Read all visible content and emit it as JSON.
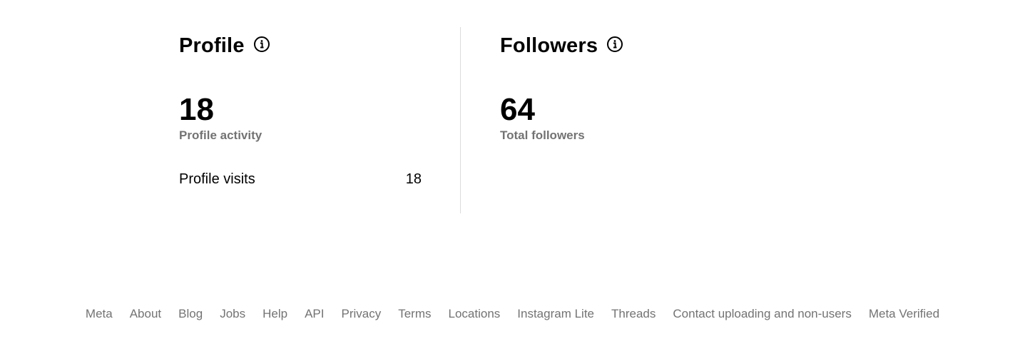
{
  "profile": {
    "title": "Profile",
    "info_icon": "info-circle-icon",
    "total": "18",
    "total_label": "Profile activity",
    "rows": [
      {
        "label": "Profile visits",
        "value": "18"
      }
    ]
  },
  "followers": {
    "title": "Followers",
    "info_icon": "info-circle-icon",
    "total": "64",
    "total_label": "Total followers"
  },
  "footer": {
    "links": [
      "Meta",
      "About",
      "Blog",
      "Jobs",
      "Help",
      "API",
      "Privacy",
      "Terms",
      "Locations",
      "Instagram Lite",
      "Threads",
      "Contact uploading and non-users",
      "Meta Verified"
    ]
  },
  "colors": {
    "text": "#000000",
    "secondary_text": "#737373",
    "divider": "#dbdbdb",
    "background": "#ffffff"
  }
}
